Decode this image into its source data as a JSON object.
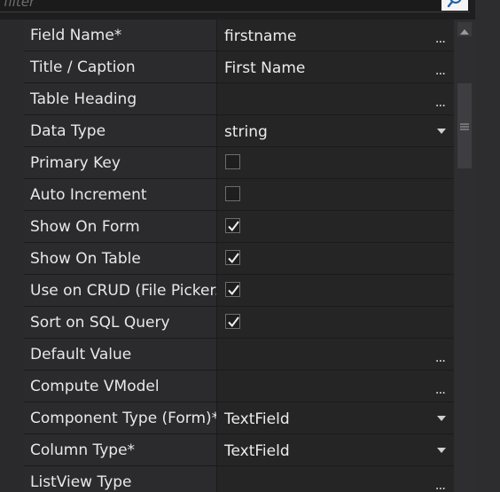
{
  "filter": {
    "placeholder": "filter"
  },
  "properties": [
    {
      "name": "Field Name*",
      "type": "text",
      "value": "firstname",
      "ellipsis": "..."
    },
    {
      "name": "Title / Caption",
      "type": "text",
      "value": "First Name",
      "ellipsis": "..."
    },
    {
      "name": "Table Heading",
      "type": "text",
      "value": "",
      "ellipsis": "..."
    },
    {
      "name": "Data Type",
      "type": "dropdown",
      "value": "string"
    },
    {
      "name": "Primary Key",
      "type": "checkbox",
      "checked": false
    },
    {
      "name": "Auto Increment",
      "type": "checkbox",
      "checked": false
    },
    {
      "name": "Show On Form",
      "type": "checkbox",
      "checked": true
    },
    {
      "name": "Show On Table",
      "type": "checkbox",
      "checked": true
    },
    {
      "name": "Use on CRUD (File Picker...",
      "type": "checkbox",
      "checked": true
    },
    {
      "name": "Sort on SQL Query",
      "type": "checkbox",
      "checked": true
    },
    {
      "name": "Default Value",
      "type": "text",
      "value": "",
      "ellipsis": "..."
    },
    {
      "name": "Compute VModel",
      "type": "text",
      "value": "",
      "ellipsis": "..."
    },
    {
      "name": "Component Type (Form)*",
      "type": "dropdown",
      "value": "TextField"
    },
    {
      "name": "Column Type*",
      "type": "dropdown",
      "value": "TextField"
    },
    {
      "name": "ListView Type",
      "type": "text",
      "value": "",
      "ellipsis": "..."
    }
  ],
  "scrollbar": {
    "position": 0.15
  },
  "colors": {
    "accent": "#007acc",
    "background": "#252526",
    "name_column": "#2b2b2d"
  },
  "icons": {
    "filter_button": "search-icon",
    "checkbox_checked": "checkmark-icon",
    "scroll_up": "chevron-up-icon",
    "thumb_grip": "grip-icon"
  }
}
